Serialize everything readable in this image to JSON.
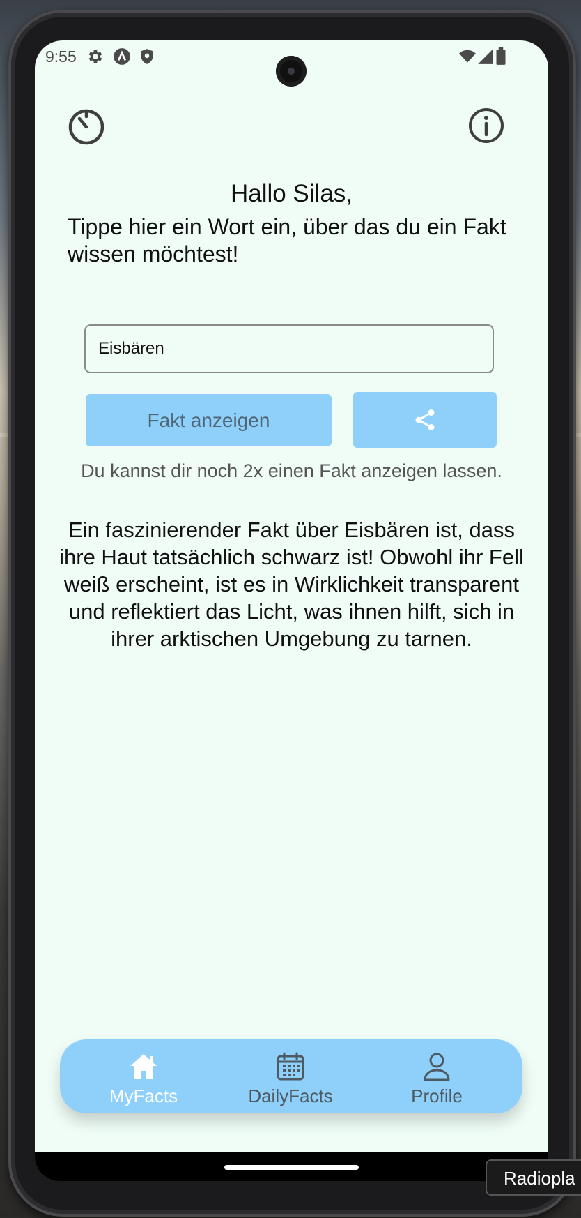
{
  "status_bar": {
    "time": "9:55",
    "left_icons": [
      "gear-icon",
      "a-circle-icon",
      "shield-icon"
    ],
    "right_icons": [
      "wifi-icon",
      "signal-icon",
      "battery-icon"
    ]
  },
  "top_bar": {
    "left_icon": "timer-icon",
    "right_icon": "info-icon"
  },
  "greeting": "Hallo Silas,",
  "prompt": "Tippe hier ein Wort ein, über das du ein Fakt wissen möchtest!",
  "search": {
    "value": "Eisbären",
    "placeholder": ""
  },
  "buttons": {
    "show_fact_label": "Fakt anzeigen",
    "share_icon": "share-icon"
  },
  "remaining_text": "Du kannst dir noch 2x einen Fakt anzeigen lassen.",
  "fact_text": "Ein faszinierender Fakt über Eisbären ist, dass ihre Haut tatsächlich schwarz ist! Obwohl ihr Fell weiß erscheint, ist es in Wirklichkeit transparent und reflektiert das Licht, was ihnen hilft, sich in ihrer arktischen Umgebung zu tarnen.",
  "nav": {
    "items": [
      {
        "label": "MyFacts",
        "icon": "home-icon",
        "active": true
      },
      {
        "label": "DailyFacts",
        "icon": "calendar-icon",
        "active": false
      },
      {
        "label": "Profile",
        "icon": "person-icon",
        "active": false
      }
    ]
  },
  "tooltip": "Radiopla",
  "colors": {
    "screen_bg": "#f0fdf7",
    "accent": "#8ed0fa",
    "nav_active_text": "#ffffff",
    "nav_text": "#4e5a62"
  }
}
